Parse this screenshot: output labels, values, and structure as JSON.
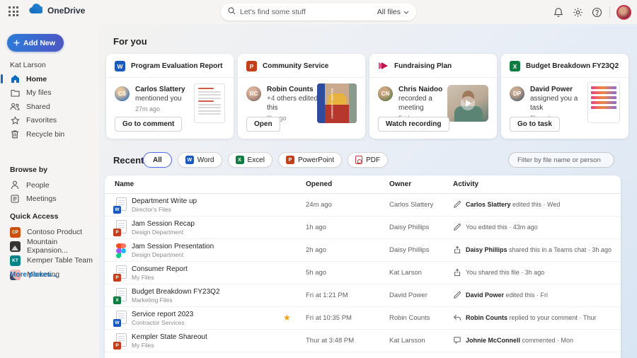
{
  "icons": {
    "star": "★",
    "help": "?",
    "word": "W",
    "ppt": "P",
    "excel": "X"
  },
  "topbar": {
    "app_title": "OneDrive",
    "search_placeholder": "Let's find some stuff",
    "search_scope": "All files"
  },
  "sidebar": {
    "add_new": "Add New",
    "user": "Kat Larson",
    "nav": [
      {
        "label": "Home"
      },
      {
        "label": "My files"
      },
      {
        "label": "Shared"
      },
      {
        "label": "Favorites"
      },
      {
        "label": "Recycle bin"
      }
    ],
    "browse_by_label": "Browse by",
    "browse": [
      {
        "label": "People"
      },
      {
        "label": "Meetings"
      }
    ],
    "quick_access_label": "Quick Access",
    "quick": [
      {
        "label": "Contoso Product",
        "badge": "CP"
      },
      {
        "label": "Mountain Expansion...",
        "badge": ""
      },
      {
        "label": "Kemper Table Team",
        "badge": "KT"
      },
      {
        "label": "Marketing",
        "badge": ""
      }
    ],
    "more_places": "More places..."
  },
  "foryou": {
    "title": "For you",
    "cards": [
      {
        "title": "Program Evaluation Report",
        "app": "Word",
        "initials": "CS",
        "name": "Carlos Slattery",
        "suffix": "",
        "action": " mentioned you",
        "time": "27m ago",
        "button": "Go to comment"
      },
      {
        "title": "Community Service",
        "app": "PowerPoint",
        "initials": "RC",
        "name": "Robin Counts",
        "suffix": " +4",
        "action": " others edited this",
        "time": "2h ago",
        "button": "Open",
        "slide_text": "COMMUNITY SERVICE"
      },
      {
        "title": "Fundraising Plan",
        "app": "Stream",
        "initials": "CN",
        "name": "Chris Naidoo",
        "suffix": "",
        "action": " recorded a meeting",
        "time": "Friday",
        "button": "Watch recording"
      },
      {
        "title": "Budget Breakdown FY23Q2",
        "app": "Excel",
        "initials": "DP",
        "name": "David Power",
        "suffix": "",
        "action": " assigned you a task",
        "time": "Thursday",
        "button": "Go to task"
      }
    ]
  },
  "recent": {
    "title": "Recent",
    "filters": [
      "All",
      "Word",
      "Excel",
      "PowerPoint",
      "PDF"
    ],
    "filter_placeholder": "Filter by file name or person"
  },
  "table": {
    "headers": [
      "Name",
      "Opened",
      "Owner",
      "Activity"
    ],
    "rows": [
      {
        "name": "Department Write up",
        "location": "Director's Files",
        "opened": "24m ago",
        "owner": "Carlos Slattery",
        "activity_name": "Carlos Slattery",
        "activity_rest": " edited this · Wed",
        "type": "word",
        "activity_icon": "edit",
        "favorite": false
      },
      {
        "name": "Jam Session Recap",
        "location": "Design Department",
        "opened": "1h ago",
        "owner": "Daisy Phillips",
        "activity_name": "",
        "activity_rest": "You edited this · 43m ago",
        "type": "ppt",
        "activity_icon": "edit",
        "favorite": false
      },
      {
        "name": "Jam Session Presentation",
        "location": "Design Department",
        "opened": "2h ago",
        "owner": "Daisy Phillips",
        "activity_name": "Daisy Phillips",
        "activity_rest": " shared this in a Teams chat · 3h ago",
        "type": "figma",
        "activity_icon": "share",
        "favorite": false
      },
      {
        "name": "Consumer Report",
        "location": "My Files",
        "opened": "5h ago",
        "owner": "Kat Larson",
        "activity_name": "",
        "activity_rest": "You shared this file · 3h ago",
        "type": "ppt",
        "activity_icon": "share",
        "favorite": false
      },
      {
        "name": "Budget Breakdown FY23Q2",
        "location": "Marketing Files",
        "opened": "Fri at 1:21 PM",
        "owner": "David Power",
        "activity_name": "David Power",
        "activity_rest": " edited this · Fri",
        "type": "excel",
        "activity_icon": "edit",
        "favorite": false
      },
      {
        "name": "Service report 2023",
        "location": "Contractor Services",
        "opened": "Fri at 10:35 PM",
        "owner": "Robin Counts",
        "activity_name": "Robin Counts",
        "activity_rest": " replied to your comment · Thur",
        "type": "word",
        "activity_icon": "reply",
        "favorite": true
      },
      {
        "name": "Kempler State Shareout",
        "location": "My Files",
        "opened": "Thur at 3:48 PM",
        "owner": "Kat Larsson",
        "activity_name": "Johnie McConnell",
        "activity_rest": " commented · Mon",
        "type": "ppt",
        "activity_icon": "comment",
        "favorite": false
      }
    ]
  }
}
